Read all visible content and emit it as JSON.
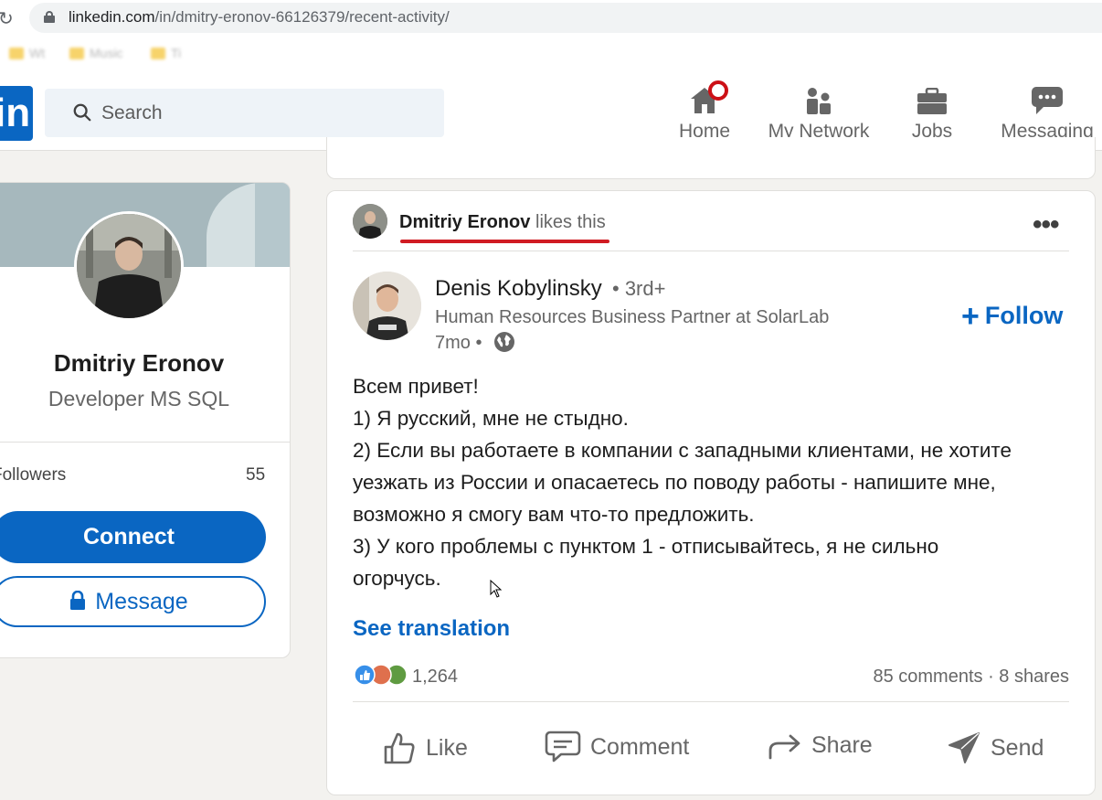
{
  "browser": {
    "url_host": "linkedin.com",
    "url_path": "/in/dmitry-eronov-66126379/recent-activity/",
    "bookmarks": [
      "Wt",
      "Music",
      "Ti"
    ]
  },
  "nav": {
    "logo": "in",
    "search_placeholder": "Search",
    "items": [
      {
        "label": "Home",
        "icon": "home-icon"
      },
      {
        "label": "My Network",
        "icon": "network-icon"
      },
      {
        "label": "Jobs",
        "icon": "briefcase-icon"
      },
      {
        "label": "Messaging",
        "icon": "messaging-icon"
      }
    ]
  },
  "profile": {
    "name": "Dmitriy Eronov",
    "headline": "Developer MS SQL",
    "followers_label": "Followers",
    "followers_count": "55",
    "connect_label": "Connect",
    "message_label": "Message"
  },
  "post": {
    "liker_name": "Dmitriy Eronov",
    "liker_action": "likes this",
    "author_name": "Denis Kobylinsky",
    "author_degree": "• 3rd+",
    "author_headline": "Human Resources Business Partner at SolarLab",
    "time": "7mo •",
    "follow_label": "Follow",
    "text_lines": [
      "Всем привет!",
      "1) Я русский, мне не стыдно.",
      "2) Если вы работаете в компании с западными клиентами, не хотите",
      "уезжать из России и опасаетесь по поводу работы - напишите мне,",
      "возможно я смогу вам что-то предложить.",
      "3) У кого проблемы с пунктом 1 - отписывайтесь, я не сильно",
      "огорчусь."
    ],
    "see_translation": "See translation",
    "reactions_count": "1,264",
    "comments_shares": "85 comments · 8 shares",
    "actions": {
      "like": "Like",
      "comment": "Comment",
      "share": "Share",
      "send": "Send"
    }
  },
  "colors": {
    "brand_blue": "#0a66c2",
    "badge_red": "#cc1016",
    "underline_red": "#d01b22"
  }
}
